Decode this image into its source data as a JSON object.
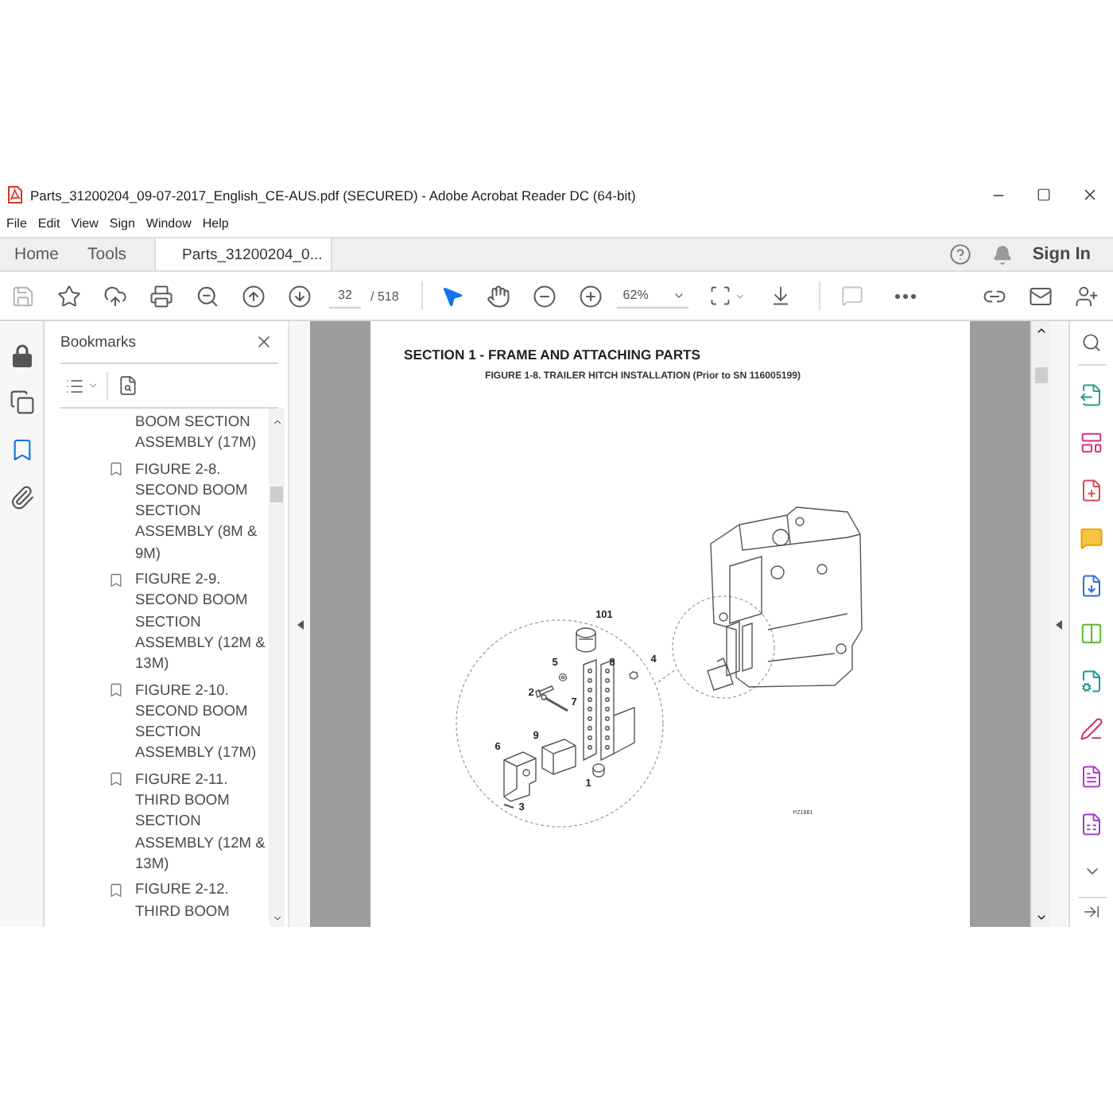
{
  "window": {
    "title": "Parts_31200204_09-07-2017_English_CE-AUS.pdf (SECURED) - Adobe Acrobat Reader DC (64-bit)"
  },
  "menu": [
    "File",
    "Edit",
    "View",
    "Sign",
    "Window",
    "Help"
  ],
  "tabs": [
    {
      "label": "Home",
      "kind": "nav",
      "selected": false
    },
    {
      "label": "Tools",
      "kind": "nav",
      "selected": false
    },
    {
      "label": "Parts_31200204_0...",
      "kind": "document",
      "selected": true
    }
  ],
  "account": {
    "sign_in": "Sign In"
  },
  "toolbar": {
    "page_number": "32",
    "page_count": "/ 518",
    "zoom": "62%",
    "tools": [
      {
        "kind": "select",
        "selected": true
      },
      {
        "kind": "hand",
        "selected": false
      }
    ]
  },
  "left_rail": [
    {
      "kind": "lock",
      "selected": false
    },
    {
      "kind": "pages",
      "selected": false
    },
    {
      "kind": "bookmarks",
      "selected": true
    },
    {
      "kind": "attachments",
      "selected": false
    }
  ],
  "bookmarks": {
    "title": "Bookmarks",
    "items": [
      {
        "kind": "continuation",
        "text": "BOOM SECTION ASSEMBLY (17M)"
      },
      {
        "kind": "entry",
        "text": "FIGURE 2-8. SECOND BOOM SECTION ASSEMBLY (8M & 9M)"
      },
      {
        "kind": "entry",
        "text": "FIGURE 2-9. SECOND BOOM SECTION ASSEMBLY (12M & 13M)"
      },
      {
        "kind": "entry",
        "text": "FIGURE 2-10. SECOND BOOM SECTION ASSEMBLY (17M)"
      },
      {
        "kind": "entry",
        "text": "FIGURE 2-11. THIRD BOOM SECTION ASSEMBLY (12M & 13M)"
      },
      {
        "kind": "entry",
        "text": "FIGURE 2-12. THIRD BOOM"
      }
    ]
  },
  "document": {
    "section_title": "SECTION 1 - FRAME AND ATTACHING PARTS",
    "figure_caption": "FIGURE 1-8. TRAILER HITCH INSTALLATION (Prior to SN 116005199)",
    "callouts": [
      "101",
      "5",
      "8",
      "4",
      "2",
      "7",
      "9",
      "6",
      "1",
      "3"
    ],
    "drawing_number": "PZ1881"
  }
}
